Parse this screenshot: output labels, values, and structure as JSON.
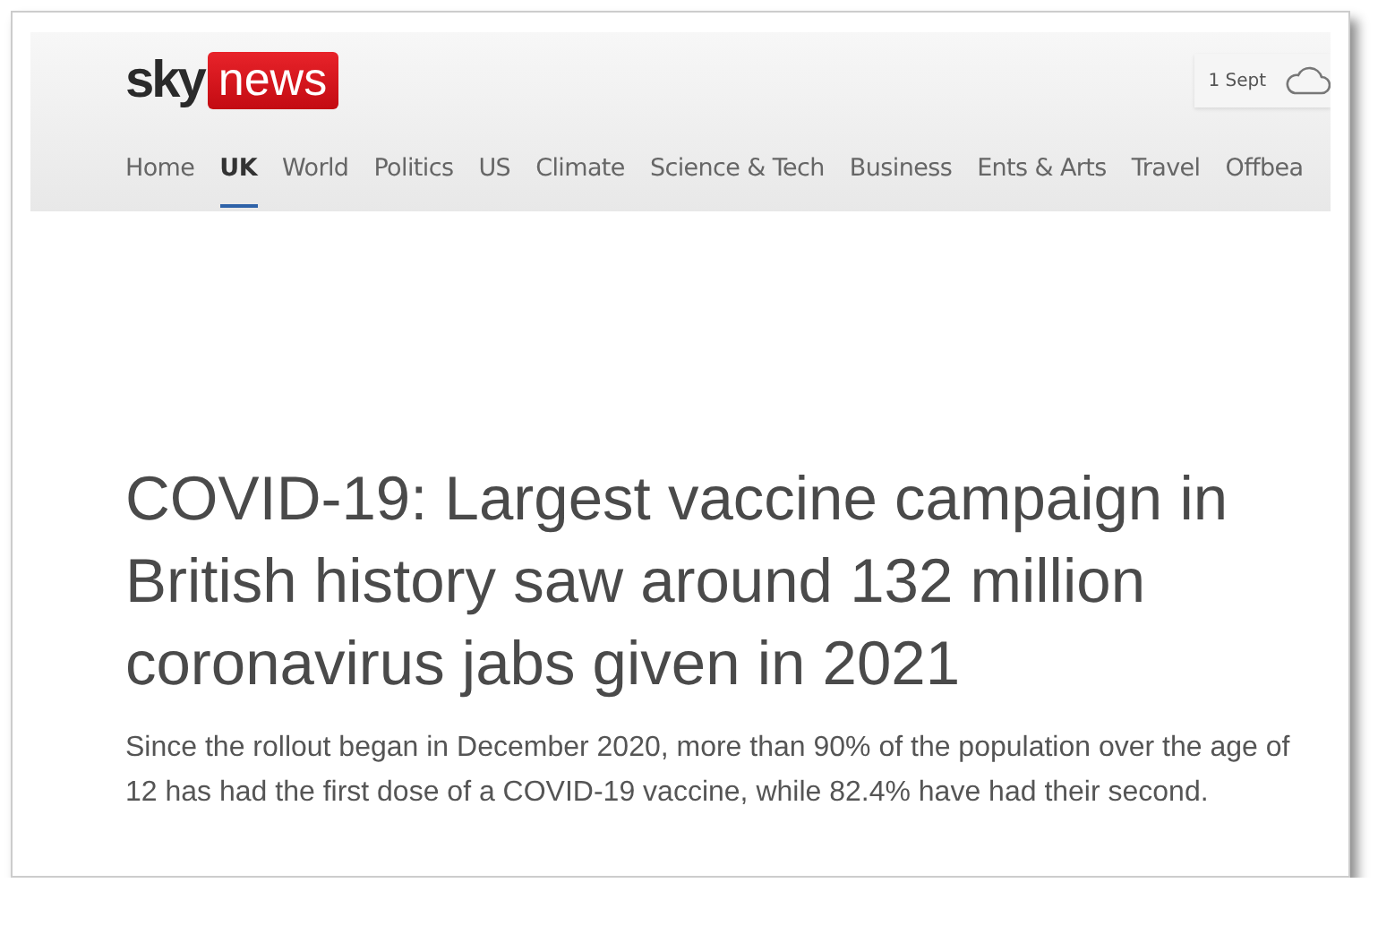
{
  "logo": {
    "brand": "sky",
    "section": "news"
  },
  "weather": {
    "date": "1 Sept"
  },
  "nav": [
    {
      "label": "Home",
      "selected": false
    },
    {
      "label": "UK",
      "selected": true
    },
    {
      "label": "World",
      "selected": false
    },
    {
      "label": "Politics",
      "selected": false
    },
    {
      "label": "US",
      "selected": false
    },
    {
      "label": "Climate",
      "selected": false
    },
    {
      "label": "Science & Tech",
      "selected": false
    },
    {
      "label": "Business",
      "selected": false
    },
    {
      "label": "Ents & Arts",
      "selected": false
    },
    {
      "label": "Travel",
      "selected": false
    },
    {
      "label": "Offbea",
      "selected": false
    }
  ],
  "article": {
    "headline": "COVID-19: Largest vaccine campaign in British history saw around 132 million coronavirus jabs given in 2021",
    "standfirst": "Since the rollout began in December 2020, more than 90% of the population over the age of 12 has had the first dose of a COVID-19 vaccine, while 82.4% have had their second."
  }
}
